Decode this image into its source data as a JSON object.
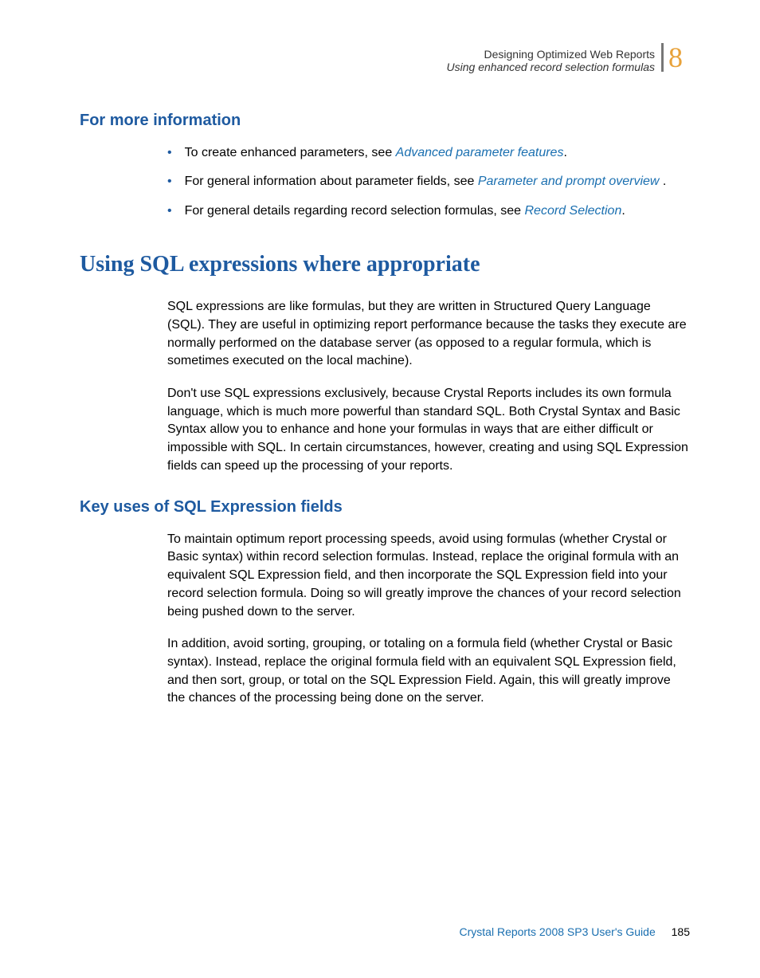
{
  "header": {
    "line1": "Designing Optimized Web Reports",
    "line2": "Using enhanced record selection formulas",
    "chapter": "8"
  },
  "section1": {
    "title": "For more information",
    "bullets": [
      {
        "pre": "To create enhanced parameters, see ",
        "link": "Advanced parameter features",
        "post": "."
      },
      {
        "pre": "For general information about parameter fields, see ",
        "link": "Parameter and prompt overview",
        "post": " ."
      },
      {
        "pre": "For general details regarding record selection formulas, see ",
        "link": "Record Selection",
        "post": "."
      }
    ]
  },
  "section2": {
    "title": "Using SQL expressions where appropriate",
    "para1": "SQL expressions are like formulas, but they are written in Structured Query Language (SQL). They are useful in optimizing report performance because the tasks they execute are normally performed on the database server (as opposed to a regular formula, which is sometimes executed on the local machine).",
    "para2": "Don't use SQL expressions exclusively, because Crystal Reports includes its own formula language, which is much more powerful than standard SQL. Both Crystal Syntax and Basic Syntax allow you to enhance and hone your formulas in ways that are either difficult or impossible with SQL. In certain circumstances, however, creating and using SQL Expression fields can speed up the processing of your reports."
  },
  "section3": {
    "title": "Key uses of SQL Expression fields",
    "para1": "To maintain optimum report processing speeds, avoid using formulas (whether Crystal or Basic syntax) within record selection formulas. Instead, replace the original formula with an equivalent SQL Expression field, and then incorporate the SQL Expression field into your record selection formula. Doing so will greatly improve the chances of your record selection being pushed down to the server.",
    "para2": "In addition, avoid sorting, grouping, or totaling on a formula field (whether Crystal or Basic syntax). Instead, replace the original formula field with an equivalent SQL Expression field, and then sort, group, or total on the SQL Expression Field. Again, this will greatly improve the chances of the processing being done on the server."
  },
  "footer": {
    "title": "Crystal Reports 2008 SP3 User's Guide",
    "page": "185"
  }
}
